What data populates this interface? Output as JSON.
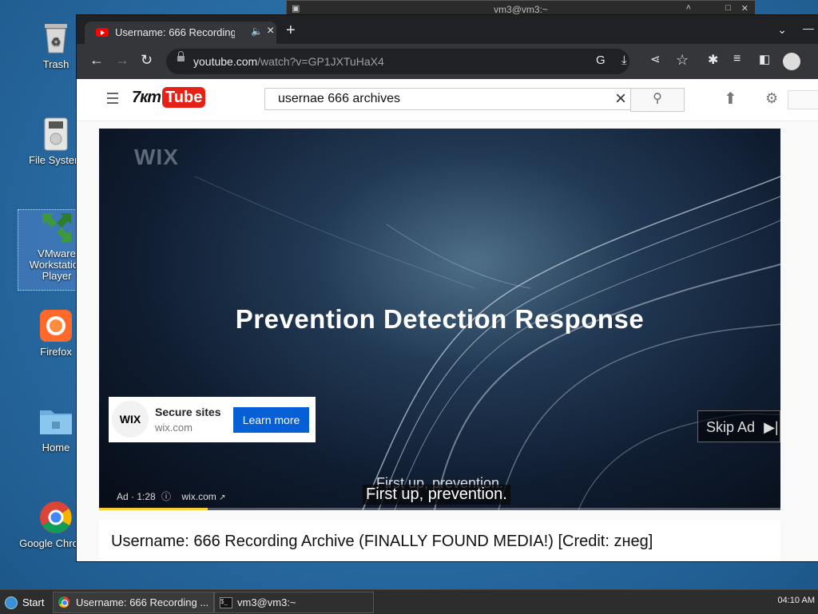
{
  "desktop": {
    "icons": [
      {
        "label": "Trash"
      },
      {
        "label": "File System"
      },
      {
        "label": "VMware Workstation Player"
      },
      {
        "label": "Firefox"
      },
      {
        "label": "Home"
      },
      {
        "label": "Google Chrome"
      }
    ]
  },
  "terminal_window": {
    "title": "vm3@vm3:~"
  },
  "browser": {
    "tab": {
      "title": "Username: 666 Recording"
    },
    "url_host": "youtube.com",
    "url_path": "/watch?v=GP1JXTuHaX4"
  },
  "page": {
    "logo_left": "7кт",
    "logo_right": "Tube",
    "search_value": "usernae 666 archives",
    "player": {
      "watermark": "WIX",
      "headline": "Prevention Detection Response",
      "ad_card": {
        "logo_text": "WIX",
        "title": "Secure sites",
        "domain": "wix.com",
        "cta": "Learn more"
      },
      "skip_label": "Skip Ad",
      "ad_info": "Ad · 1:28",
      "ad_link": "wix.com",
      "caption_burned": "First up, prevention.",
      "caption": "First up, prevention.",
      "progress": 0.16
    },
    "video_title": "Username: 666 Recording Archive (FINALLY FOUND MEDIA!) [Credit: zнeg]"
  },
  "taskbar": {
    "start_label": "Start",
    "tasks": [
      {
        "label": "Username: 666 Recording ..."
      },
      {
        "label": "vm3@vm3:~"
      }
    ],
    "clock": "04:10 AM"
  }
}
